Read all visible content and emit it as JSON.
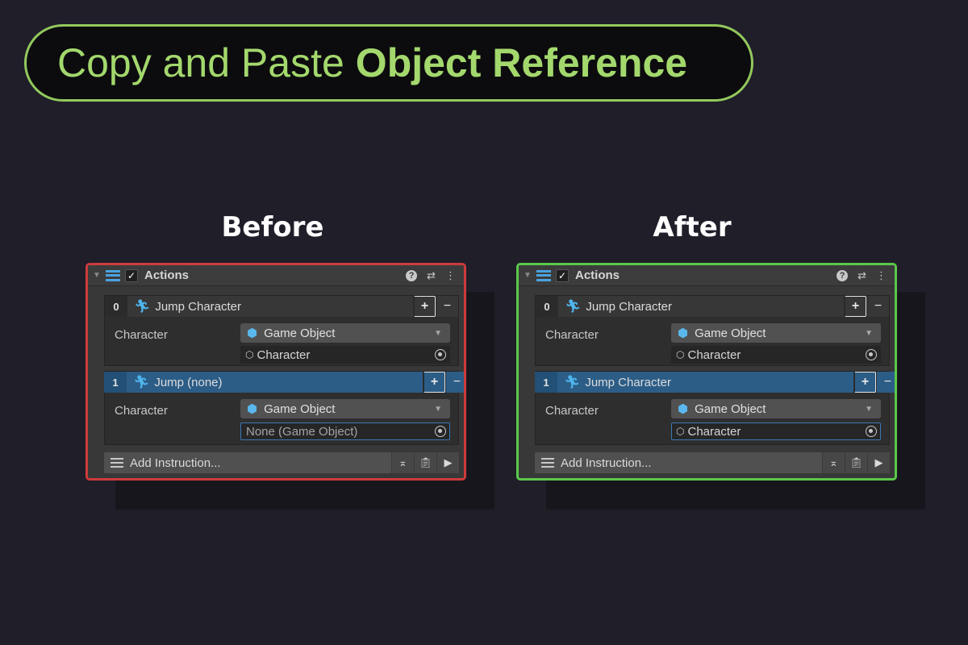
{
  "title": {
    "regular": "Copy and Paste",
    "bold": "Object Reference"
  },
  "colors": {
    "before_border": "#cd3b3b",
    "after_border": "#5ac84a",
    "title_accent": "#a3d86d",
    "selection": "#2c5d87"
  },
  "before": {
    "label": "Before",
    "header": {
      "title": "Actions",
      "check": "✓",
      "help": "?",
      "presets": "⇄",
      "more": "⋮"
    },
    "items": [
      {
        "index": "0",
        "name": "Jump Character",
        "selected": false,
        "field_label": "Character",
        "dropdown": "Game Object",
        "object_value": "Character",
        "object_placeholder": false
      },
      {
        "index": "1",
        "name": "Jump (none)",
        "selected": true,
        "field_label": "Character",
        "dropdown": "Game Object",
        "object_value": "None (Game Object)",
        "object_placeholder": true
      }
    ],
    "add_instruction": "Add Instruction..."
  },
  "after": {
    "label": "After",
    "header": {
      "title": "Actions",
      "check": "✓",
      "help": "?",
      "presets": "⇄",
      "more": "⋮"
    },
    "items": [
      {
        "index": "0",
        "name": "Jump Character",
        "selected": false,
        "field_label": "Character",
        "dropdown": "Game Object",
        "object_value": "Character",
        "object_placeholder": false
      },
      {
        "index": "1",
        "name": "Jump Character",
        "selected": true,
        "field_label": "Character",
        "dropdown": "Game Object",
        "object_value": "Character",
        "object_placeholder": false
      }
    ],
    "add_instruction": "Add Instruction..."
  },
  "icons": {
    "runner": "runner-icon",
    "cube": "cube-icon",
    "object": "object-icon",
    "target": "object-picker-icon"
  }
}
